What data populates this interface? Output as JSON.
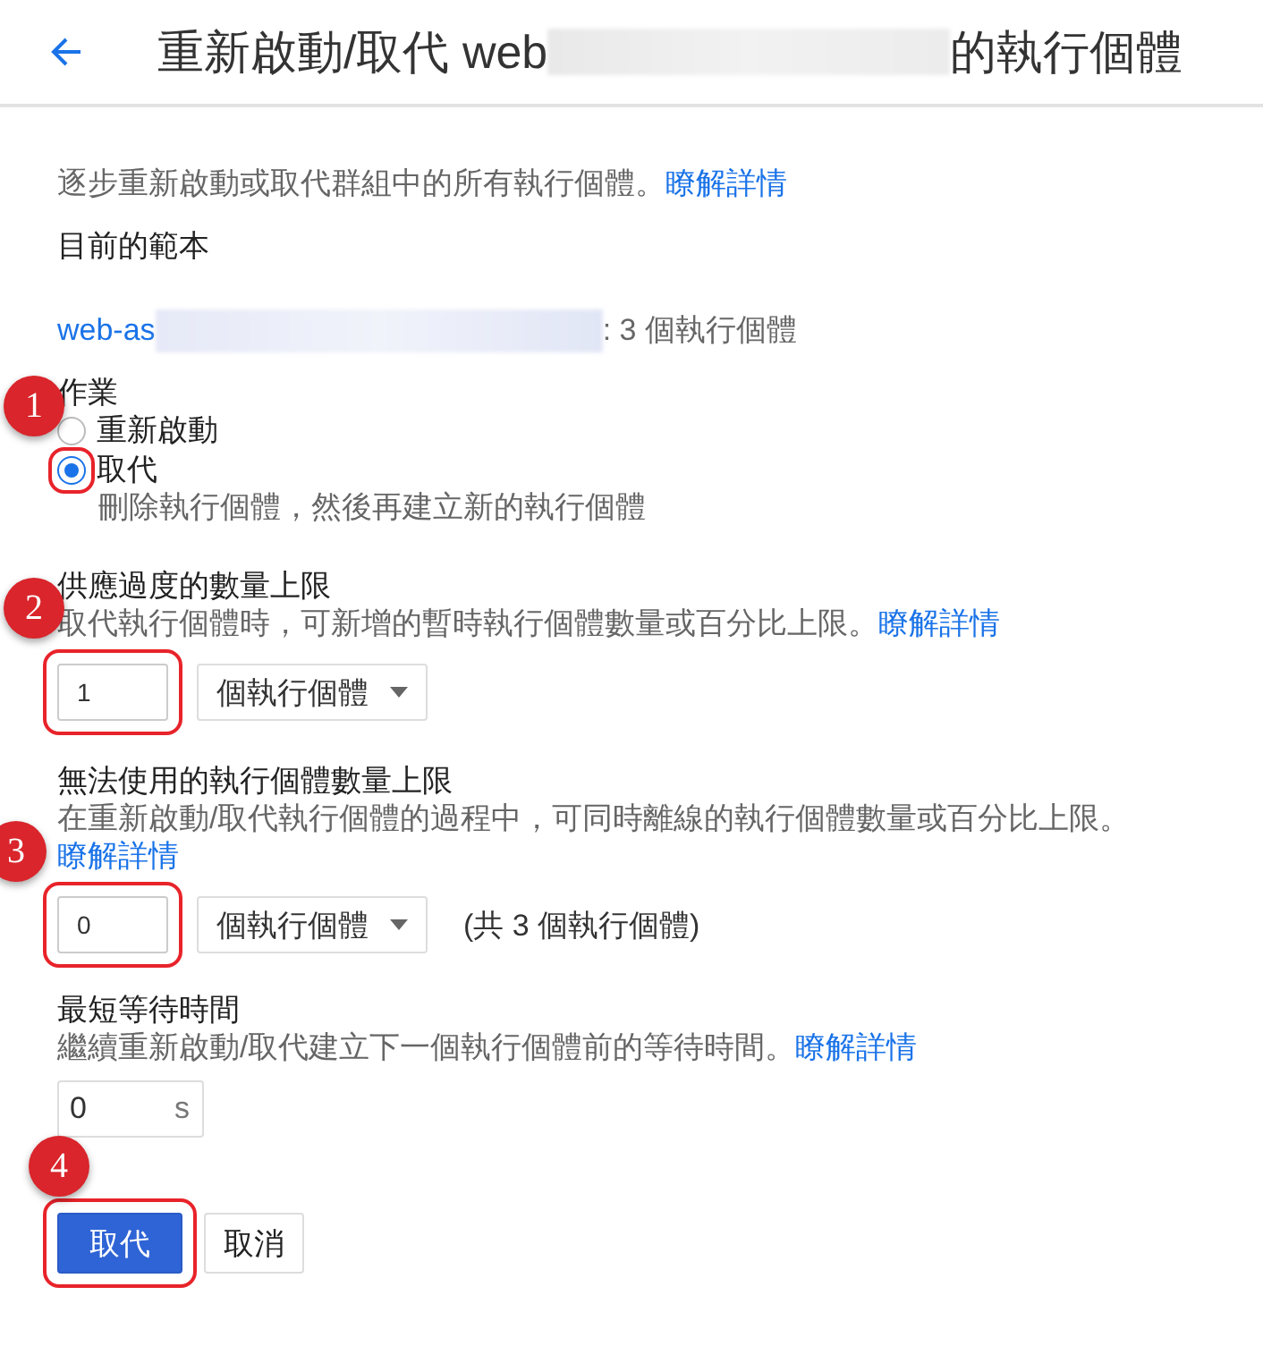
{
  "header": {
    "title_start": "重新啟動/取代 web",
    "redacted": true,
    "title_end": "的執行個體"
  },
  "intro": {
    "text": "逐步重新啟動或取代群組中的所有執行個體。",
    "link": "瞭解詳情"
  },
  "template": {
    "label": "目前的範本",
    "link": "web-as",
    "redacted": true,
    "count": ": 3 個執行個體"
  },
  "operation": {
    "label": "作業",
    "options": [
      {
        "label": "重新啟動",
        "selected": false
      },
      {
        "label": "取代",
        "selected": true,
        "help": "刪除執行個體，然後再建立新的執行個體",
        "callout": "1"
      }
    ]
  },
  "limits": [
    {
      "title": "供應過度的數量上限",
      "desc": "取代執行個體時，可新增的暫時執行個體數量或百分比上限。",
      "link": "瞭解詳情",
      "value": "1",
      "unit": "個執行個體",
      "callout": "2"
    },
    {
      "title": "無法使用的執行個體數量上限",
      "desc": "在重新啟動/取代執行個體的過程中，可同時離線的執行個體數量或百分比上限。",
      "link": "瞭解詳情",
      "value": "0",
      "unit": "個執行個體",
      "note": "(共 3 個執行個體)",
      "callout": "3"
    }
  ],
  "wait": {
    "title": "最短等待時間",
    "desc": "繼續重新啟動/取代建立下一個執行個體前的等待時間。",
    "link": "瞭解詳情",
    "value": "0",
    "suffix": "s"
  },
  "buttons": [
    {
      "label": "取代",
      "kind": "primary",
      "callout": "4"
    },
    {
      "label": "取消",
      "kind": "secondary"
    }
  ]
}
